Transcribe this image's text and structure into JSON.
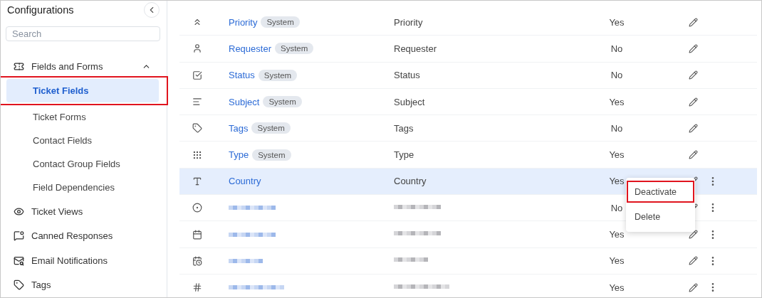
{
  "sidebar": {
    "title": "Configurations",
    "search": {
      "placeholder": "Search"
    },
    "items": [
      {
        "label": "Fields and Forms",
        "expanded": true,
        "children": [
          {
            "label": "Ticket Fields",
            "selected": true,
            "annotated": true
          },
          {
            "label": "Ticket Forms",
            "selected": false,
            "annotated": false
          },
          {
            "label": "Contact Fields",
            "selected": false,
            "annotated": false
          },
          {
            "label": "Contact Group Fields",
            "selected": false,
            "annotated": false
          },
          {
            "label": "Field Dependencies",
            "selected": false,
            "annotated": false
          }
        ]
      },
      {
        "label": "Ticket Views"
      },
      {
        "label": "Canned Responses"
      },
      {
        "label": "Email Notifications"
      },
      {
        "label": "Tags"
      }
    ]
  },
  "table": {
    "rows": [
      {
        "kind": "field",
        "name": "Priority",
        "badge": "System",
        "label": "Priority",
        "column_4": "Yes",
        "selected": false,
        "menu": false
      },
      {
        "kind": "field",
        "name": "Requester",
        "badge": "System",
        "label": "Requester",
        "column_4": "No",
        "selected": false,
        "menu": false
      },
      {
        "kind": "field",
        "name": "Status",
        "badge": "System",
        "label": "Status",
        "column_4": "No",
        "selected": false,
        "menu": false
      },
      {
        "kind": "field",
        "name": "Subject",
        "badge": "System",
        "label": "Subject",
        "column_4": "Yes",
        "selected": false,
        "menu": false
      },
      {
        "kind": "field",
        "name": "Tags",
        "badge": "System",
        "label": "Tags",
        "column_4": "No",
        "selected": false,
        "menu": false
      },
      {
        "kind": "field",
        "name": "Type",
        "badge": "System",
        "label": "Type",
        "column_4": "Yes",
        "selected": false,
        "menu": false
      },
      {
        "kind": "field",
        "name": "Country",
        "label": "Country",
        "column_4": "Yes",
        "selected": true,
        "menu": true
      },
      {
        "kind": "redacted",
        "column_4": "No",
        "selected": false,
        "menu": true
      },
      {
        "kind": "redacted",
        "column_4": "Yes",
        "selected": false,
        "menu": true
      },
      {
        "kind": "redacted",
        "column_4": "Yes",
        "selected": false,
        "menu": true
      },
      {
        "kind": "redacted",
        "column_4": "Yes",
        "selected": false,
        "menu": true
      }
    ]
  },
  "context_menu": {
    "items": [
      {
        "label": "Deactivate",
        "annotated": true
      },
      {
        "label": "Delete",
        "annotated": false
      }
    ]
  }
}
